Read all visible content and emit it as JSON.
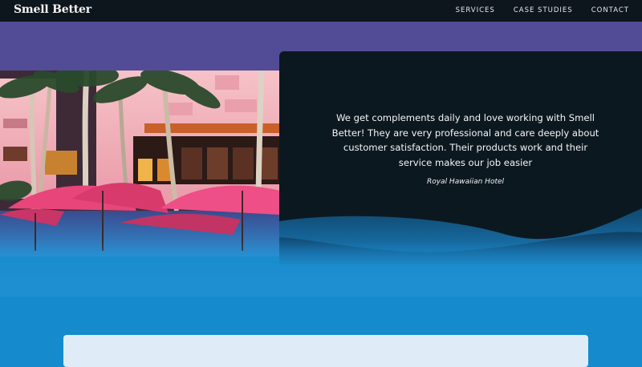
{
  "navbar": {
    "brand": "Smell Better",
    "links": [
      {
        "label": "SERVICES"
      },
      {
        "label": "CASE STUDIES"
      },
      {
        "label": "CONTACT"
      }
    ]
  },
  "testimonial": {
    "quote": "We get complements daily and love working with Smell Better! They are very professional and care deeply about customer satisfaction. Their products work and their service makes our job easier",
    "author": "Royal Hawaiian Hotel"
  },
  "colors": {
    "navbar_bg": "#0d161d",
    "purple_band": "#524c96",
    "card_bg": "#0c1820",
    "ocean_blue": "#158bcd",
    "panel_light": "#dfecf7",
    "hotel_pink": "#f2a9b3",
    "umbrella_pink": "#e8457a"
  }
}
